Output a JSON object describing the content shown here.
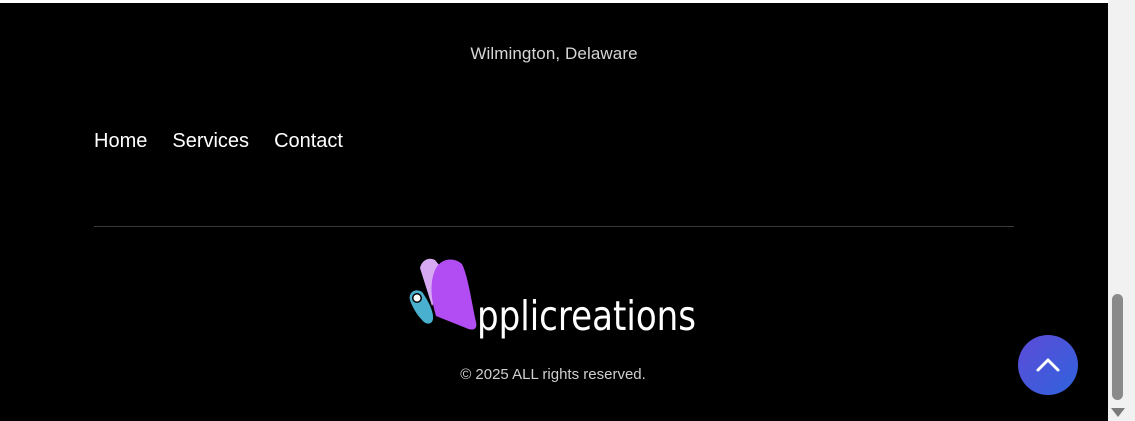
{
  "footer": {
    "location": "Wilmington, Delaware",
    "nav": [
      {
        "label": "Home"
      },
      {
        "label": "Services"
      },
      {
        "label": "Contact"
      }
    ],
    "brand": {
      "wordmark": "pplicreations",
      "icon": "butterfly-a-logo-icon",
      "colors": {
        "purple": "#b24cf3",
        "lavender": "#d7a9f2",
        "teal": "#4ab0cf",
        "white": "#ffffff"
      }
    },
    "copyright": "© 2025 ALL rights reserved."
  },
  "scroll_top": {
    "icon": "chevron-up-icon",
    "color_start": "#5d4bd8",
    "color_end": "#2f63dd"
  }
}
